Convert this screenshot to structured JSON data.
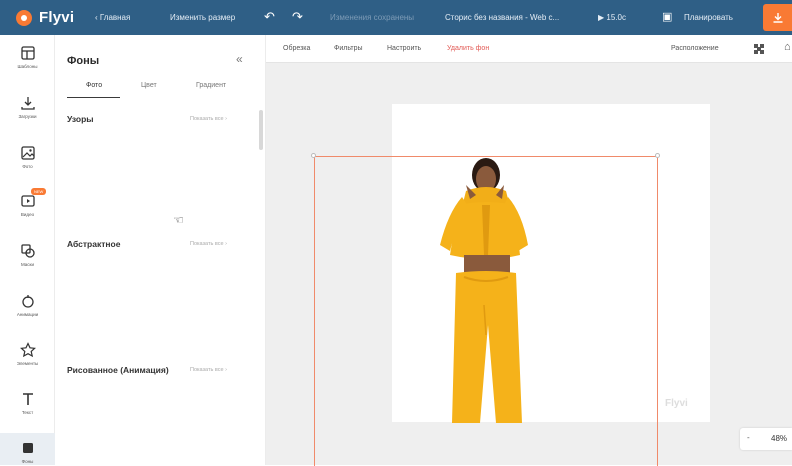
{
  "app": {
    "name": "Flyvi"
  },
  "topbar": {
    "home": "‹ Главная",
    "resize": "Изменить размер",
    "saved_status": "Изменения сохранены",
    "doc_title": "Сторис без названия - Web с...",
    "duration": "15.0с",
    "schedule": "Планировать"
  },
  "rail": {
    "items": [
      {
        "label": "Шаблоны",
        "icon": "templates-icon"
      },
      {
        "label": "Загрузки",
        "icon": "upload-icon"
      },
      {
        "label": "Фото",
        "icon": "photo-icon"
      },
      {
        "label": "Видео",
        "icon": "video-icon",
        "badge": "NEW"
      },
      {
        "label": "Маски",
        "icon": "masks-icon"
      },
      {
        "label": "Анимации",
        "icon": "animation-icon"
      },
      {
        "label": "Элементы",
        "icon": "star-icon"
      },
      {
        "label": "Текст",
        "icon": "text-icon"
      },
      {
        "label": "Фоны",
        "icon": "backgrounds-icon"
      }
    ]
  },
  "panel": {
    "title": "Фоны",
    "tabs": [
      "Фото",
      "Цвет",
      "Градиент"
    ],
    "sections": [
      {
        "title": "Узоры",
        "show_all": "Показать все ›"
      },
      {
        "title": "Абстрактное",
        "show_all": "Показать все ›"
      },
      {
        "title": "Рисованное (Анимация)",
        "show_all": "Показать все ›"
      }
    ]
  },
  "toolbar": {
    "crop": "Обрезка",
    "filters": "Фильтры",
    "adjust": "Настроить",
    "remove_bg": "Удалить фон",
    "position": "Расположение"
  },
  "canvas": {
    "watermark": "Flyvi"
  },
  "zoom": {
    "minus": "-",
    "value": "48%"
  },
  "colors": {
    "accent": "#f97a34",
    "topbar": "#2f5f86",
    "hoodie": "#f5b21a",
    "remove_bg": "#e25a55"
  }
}
